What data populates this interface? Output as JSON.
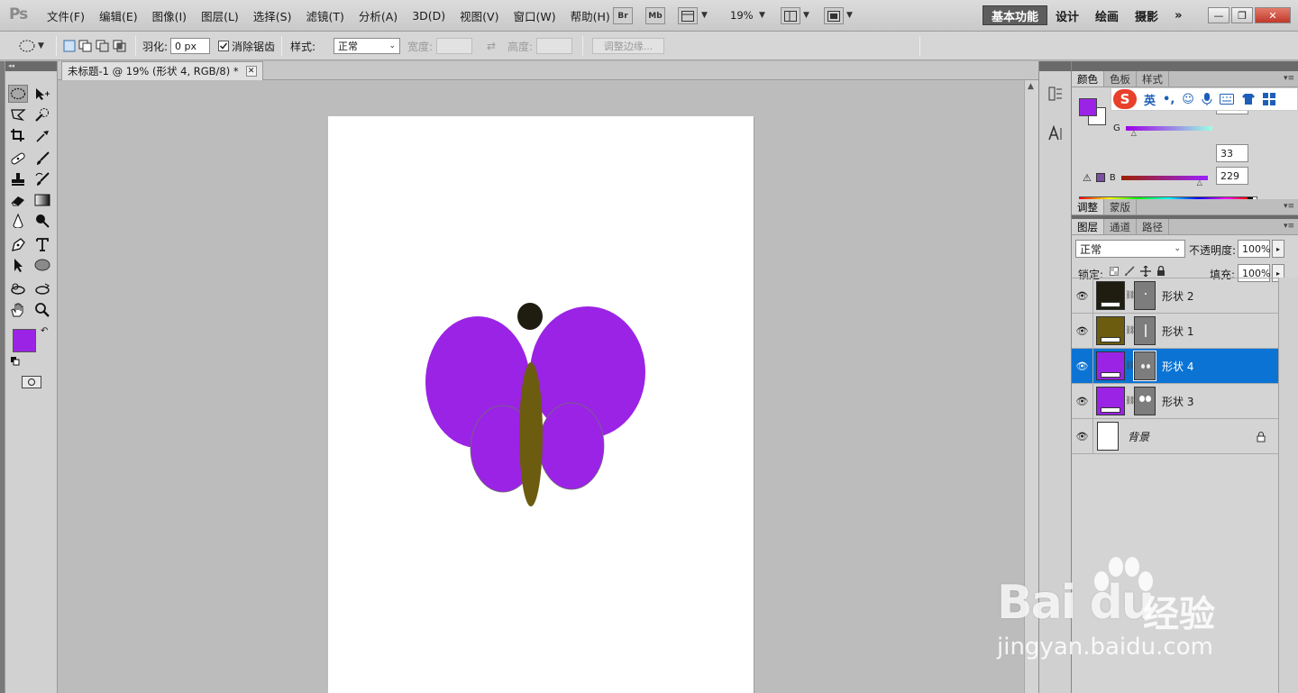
{
  "app": {
    "logo": "Ps"
  },
  "menu": [
    "文件(F)",
    "编辑(E)",
    "图像(I)",
    "图层(L)",
    "选择(S)",
    "滤镜(T)",
    "分析(A)",
    "3D(D)",
    "视图(V)",
    "窗口(W)",
    "帮助(H)"
  ],
  "appbar": {
    "br": "Br",
    "mb": "Mb",
    "zoom": "19%"
  },
  "workspaces": [
    "基本功能",
    "设计",
    "绘画",
    "摄影",
    "»"
  ],
  "window_buttons": {
    "min": "—",
    "restore": "❐",
    "close": "✕"
  },
  "options": {
    "feather_label": "羽化:",
    "feather_value": "0 px",
    "antialias_label": "消除锯齿",
    "style_label": "样式:",
    "style_value": "正常",
    "width_label": "宽度:",
    "height_label": "高度:",
    "refine_label": "调整边缘..."
  },
  "document": {
    "tab_title": "未标题-1 @ 19% (形状 4, RGB/8) *"
  },
  "colors": {
    "foreground": "#9b23e5",
    "wing": "#9b23e5",
    "body": "#6b5c10",
    "head": "#1f1d10"
  },
  "color_panel": {
    "tabs": [
      "颜色",
      "色板",
      "样式"
    ],
    "channels": [
      {
        "label": "R",
        "value": ""
      },
      {
        "label": "G",
        "value": "33"
      },
      {
        "label": "B",
        "value": "229"
      }
    ]
  },
  "ime": {
    "lang": "英"
  },
  "adjust_panel": {
    "tabs": [
      "调整",
      "蒙版"
    ]
  },
  "layers_panel": {
    "tabs": [
      "图层",
      "通道",
      "路径"
    ],
    "blend_mode": "正常",
    "opacity_label": "不透明度:",
    "opacity_value": "100%",
    "lock_label": "锁定:",
    "fill_label": "填充:",
    "fill_value": "100%",
    "layers": [
      {
        "name": "形状 2",
        "color": "#1f1d10",
        "selected": false
      },
      {
        "name": "形状 1",
        "color": "#6b5c10",
        "selected": false
      },
      {
        "name": "形状 4",
        "color": "#9b23e5",
        "selected": true
      },
      {
        "name": "形状 3",
        "color": "#9b23e5",
        "selected": false
      },
      {
        "name": "背景",
        "color": "#ffffff",
        "selected": false
      }
    ]
  },
  "watermark": {
    "brand": "Bai du",
    "brand_cn": "经验",
    "url": "jingyan.baidu.com"
  }
}
